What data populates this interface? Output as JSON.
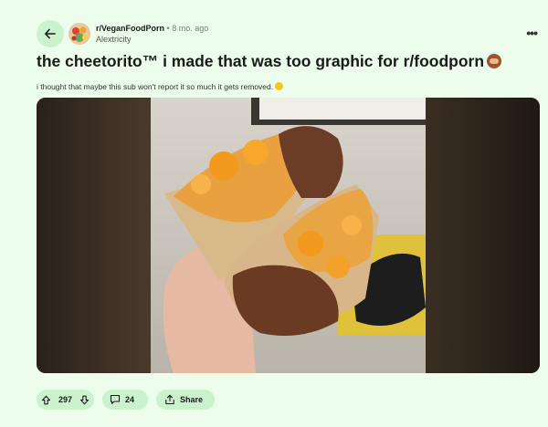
{
  "post": {
    "subreddit": "r/VeganFoodPorn",
    "separator": "•",
    "age": "8 mo. ago",
    "author": "Alextricity",
    "title": "the cheetorito™ i made that was too graphic for r/foodporn",
    "body": "i thought that maybe this sub won't report it so much it gets removed."
  },
  "actions": {
    "votes": "297",
    "comments": "24",
    "share_label": "Share"
  },
  "icons": {
    "back": "back-arrow-icon",
    "more": "more-options-icon",
    "upvote": "upvote-arrow-icon",
    "downvote": "downvote-arrow-icon",
    "comment": "comment-bubble-icon",
    "share": "share-icon",
    "title_emoji": "see-no-evil-monkey-emoji",
    "body_emoji": "laughing-emoji"
  },
  "colors": {
    "background": "#ecfdec",
    "pill": "#c9f2cd",
    "text": "#1a1a1b",
    "muted": "#7c7c7c"
  }
}
